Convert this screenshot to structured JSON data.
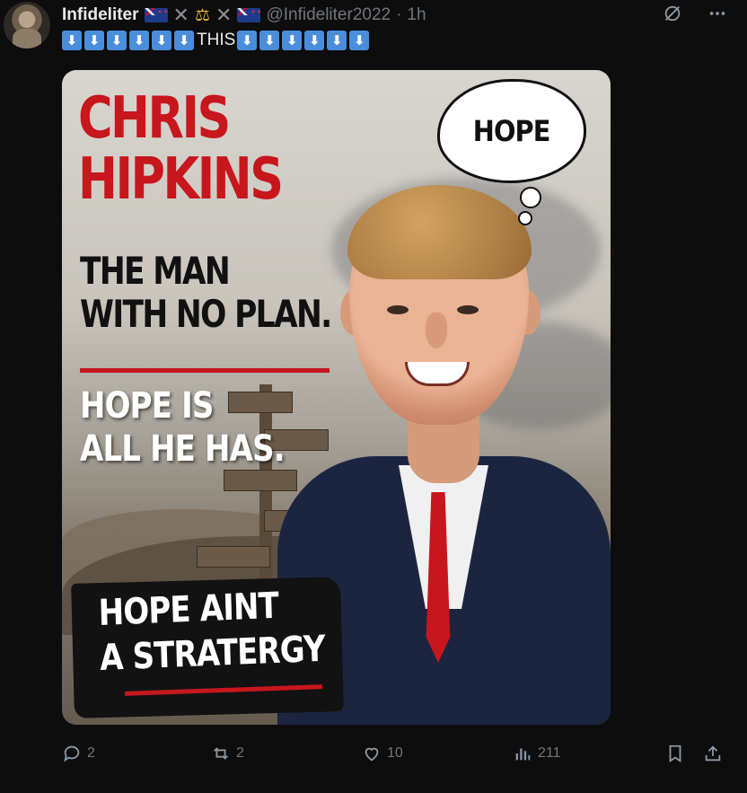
{
  "post": {
    "display_name": "Infideliter",
    "handle": "@Infideliter2022",
    "separator": "·",
    "time": "1h",
    "text_mid": "THIS",
    "arrow_glyph": "⬇",
    "arrows_before": 6,
    "arrows_after": 6
  },
  "image": {
    "headline_line1": "CHRIS",
    "headline_line2": "HIPKINS",
    "sub_line1": "THE MAN",
    "sub_line2": "WITH NO PLAN.",
    "hope_line1": "HOPE IS",
    "hope_line2": "ALL HE HAS.",
    "strategy_line1": "HOPE AINT",
    "strategy_line2": "A STRATERGY",
    "bubble_text": "HOPE"
  },
  "actions": {
    "replies": "2",
    "reposts": "2",
    "likes": "10",
    "views": "211"
  },
  "colors": {
    "accent_red": "#c8161d",
    "muted": "#71767b",
    "background": "#0d0d0d"
  }
}
